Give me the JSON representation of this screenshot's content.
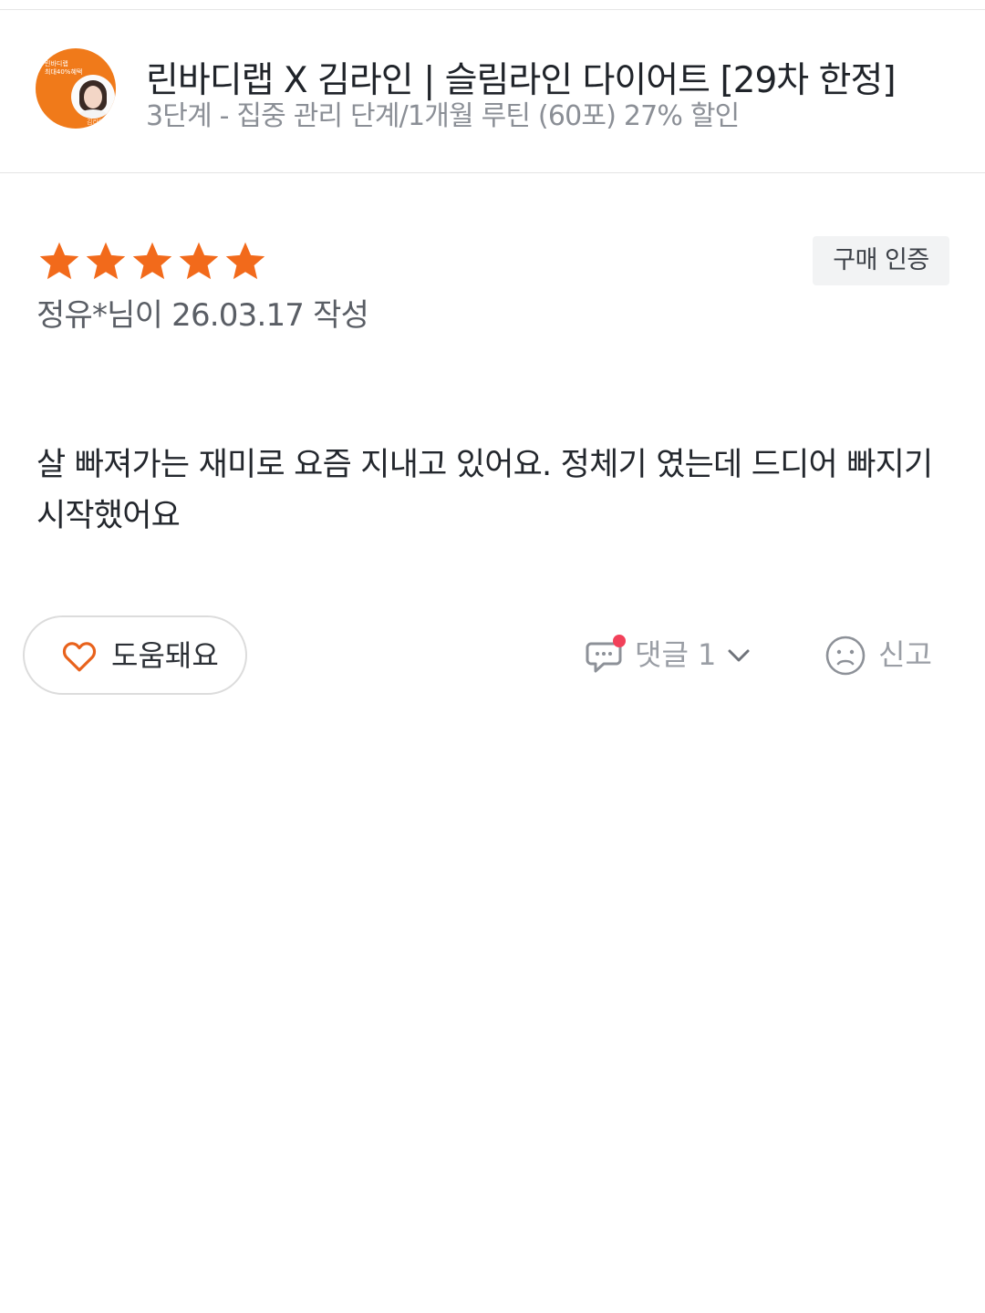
{
  "product": {
    "thumbnail_promo_line1": "린바디랩",
    "thumbnail_promo_line2": "최대40%혜택",
    "thumbnail_brand": "김라인",
    "title": "린바디랩 X 김라인 | 슬림라인 다이어트 [29차 한정]",
    "option": "3단계 - 집중 관리 단계/1개월 루틴 (60포) 27% 할인"
  },
  "review": {
    "rating_stars": 5,
    "rating_max": 5,
    "star_color": "#f26a1b",
    "purchase_badge": "구매 인증",
    "meta": "정유*님이 26.03.17 작성",
    "body": "살 빠져가는 재미로 요즘 지내고 있어요. 정체기 였는데 드디어 빠지기 시작했어요"
  },
  "actions": {
    "helpful_label": "도움돼요",
    "comments_label": "댓글 1",
    "report_label": "신고",
    "notification_dot_color": "#f2415a"
  }
}
